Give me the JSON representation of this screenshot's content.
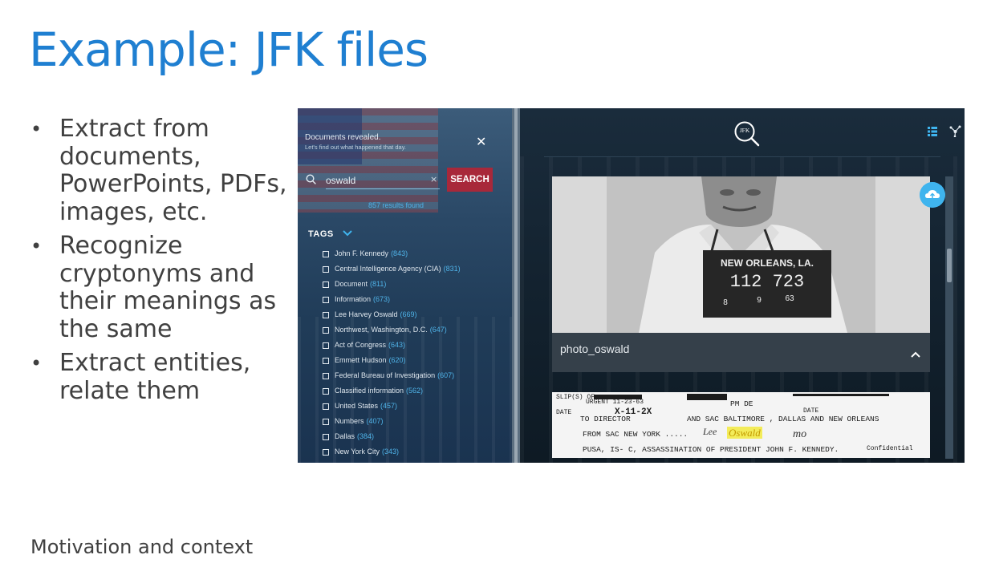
{
  "slide": {
    "title": "Example: JFK files",
    "bullets": [
      "Extract from documents, PowerPoints, PDFs, images, etc.",
      "Recognize cryptonyms and their meanings as the same",
      "Extract entities, relate them"
    ],
    "footer": "Motivation and context"
  },
  "app": {
    "left_panel": {
      "message": "Documents revealed.",
      "submessage": "Let's find out what happened that day.",
      "close_glyph": "✕",
      "search_value": "oswald",
      "clear_glyph": "×",
      "search_button": "SEARCH",
      "results": "857 results found",
      "tags_label": "TAGS",
      "tags": [
        {
          "name": "John F. Kennedy",
          "count": "(843)"
        },
        {
          "name": "Central Intelligence Agency (CIA)",
          "count": "(831)"
        },
        {
          "name": "Document",
          "count": "(811)"
        },
        {
          "name": "Information",
          "count": "(673)"
        },
        {
          "name": "Lee Harvey Oswald",
          "count": "(669)"
        },
        {
          "name": "Northwest, Washington, D.C.",
          "count": "(647)"
        },
        {
          "name": "Act of Congress",
          "count": "(643)"
        },
        {
          "name": "Emmett Hudson",
          "count": "(620)"
        },
        {
          "name": "Federal Bureau of Investigation",
          "count": "(607)"
        },
        {
          "name": "Classified information",
          "count": "(562)"
        },
        {
          "name": "United States",
          "count": "(457)"
        },
        {
          "name": "Numbers",
          "count": "(407)"
        },
        {
          "name": "Dallas",
          "count": "(384)"
        },
        {
          "name": "New York City",
          "count": "(343)"
        }
      ]
    },
    "right_panel": {
      "logo_text": "JFK",
      "photo_placard": {
        "line1": "NEW ORLEANS, LA.",
        "line2": "112 723",
        "line3": [
          "8",
          "9",
          "63"
        ]
      },
      "card_caption": "photo_oswald",
      "document": {
        "slip": "SLIP(S) OF",
        "urgent": "URGENT 11-23-63",
        "date_label": "DATE",
        "date_value": "X-11-2X",
        "pm": "PM DE",
        "to_director": "TO DIRECTOR",
        "and_sac": "AND SAC BALTIMORE , DALLAS AND NEW ORLEANS",
        "date_right": "DATE",
        "from_sac": "FROM SAC NEW YORK .....",
        "lee": "Lee",
        "oswald": "Oswald",
        "mo": "mo",
        "line3": "PUSA, IS- C, ASSASSINATION OF PRESIDENT JOHN F. KENNEDY.",
        "confidential": "Confidential"
      }
    }
  },
  "colors": {
    "title_blue": "#1f7fd1",
    "search_button_red": "#a8283a",
    "accent_cyan": "#4fb3e8",
    "highlight_yellow": "#f3ec5a"
  }
}
